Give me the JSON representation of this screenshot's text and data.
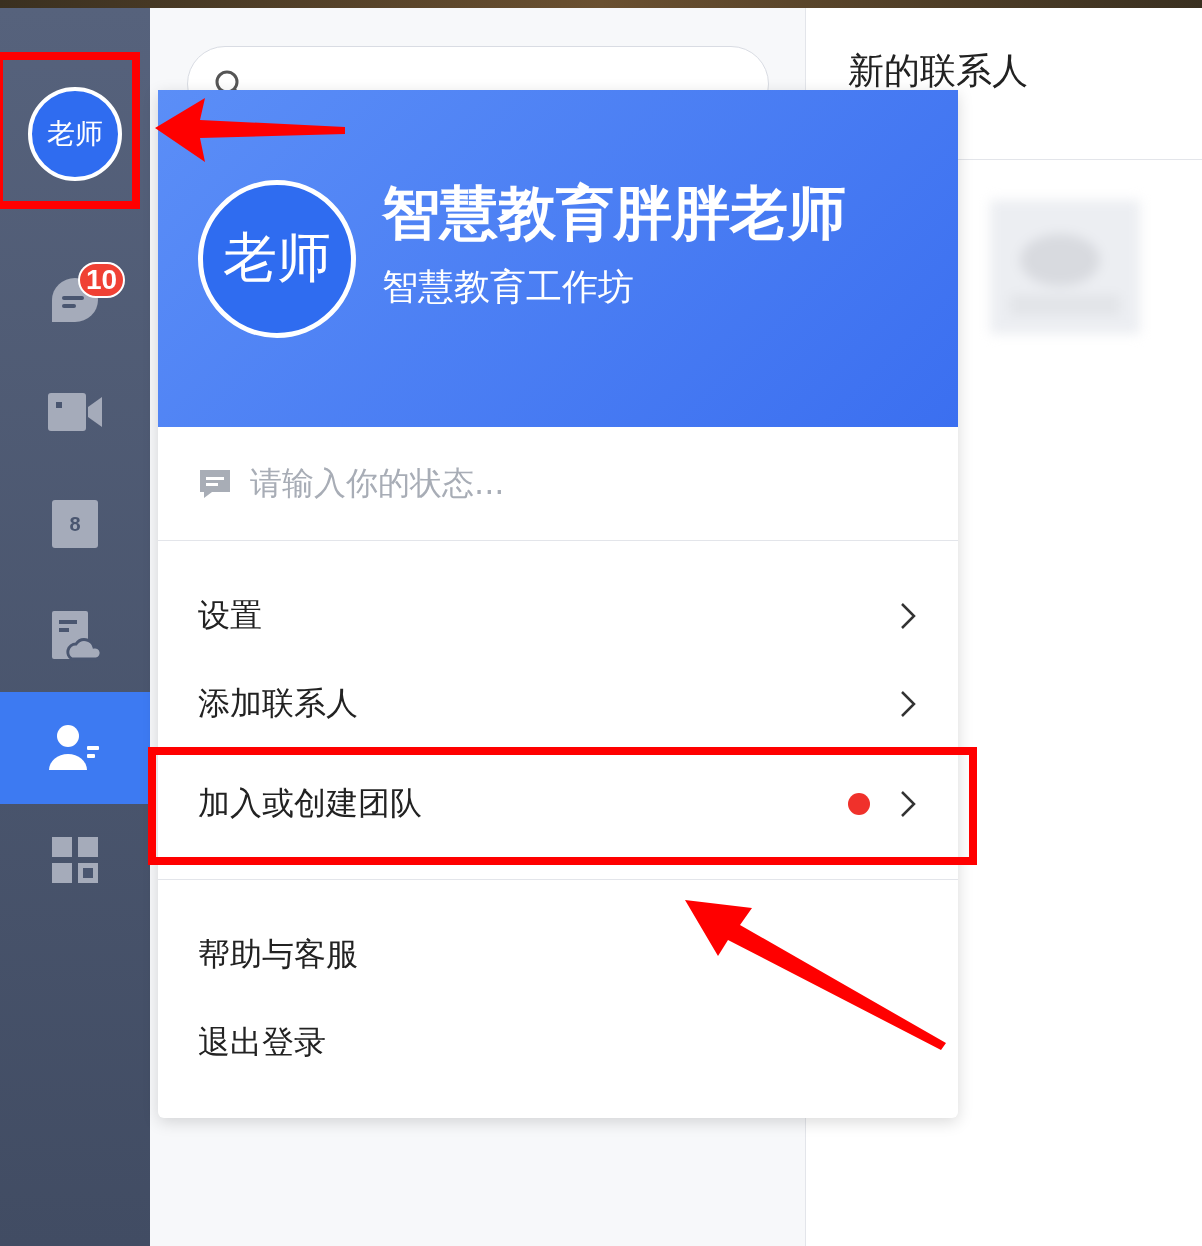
{
  "sidebar": {
    "avatar": {
      "label": "老师",
      "highlighted": true
    },
    "nav_items": [
      {
        "kind": "chat",
        "selected": false,
        "badge": "10"
      },
      {
        "kind": "video",
        "selected": false
      },
      {
        "kind": "calendar",
        "selected": false,
        "day": "8"
      },
      {
        "kind": "docs",
        "selected": false
      },
      {
        "kind": "contacts",
        "selected": true
      },
      {
        "kind": "apps",
        "selected": false
      }
    ]
  },
  "right_pane": {
    "title": "新的联系人"
  },
  "profile_popup": {
    "avatar_label": "老师",
    "name": "智慧教育胖胖老师",
    "organization": "智慧教育工作坊",
    "status_placeholder": "请输入你的状态...",
    "menu_groups": [
      [
        {
          "label": "设置",
          "has_arrow": true,
          "new_dot": false,
          "highlighted": false
        },
        {
          "label": "添加联系人",
          "has_arrow": true,
          "new_dot": false,
          "highlighted": false
        },
        {
          "label": "加入或创建团队",
          "has_arrow": true,
          "new_dot": true,
          "highlighted": true
        }
      ],
      [
        {
          "label": "帮助与客服",
          "has_arrow": false,
          "new_dot": false,
          "highlighted": false
        },
        {
          "label": "退出登录",
          "has_arrow": false,
          "new_dot": false,
          "highlighted": false
        }
      ]
    ]
  }
}
